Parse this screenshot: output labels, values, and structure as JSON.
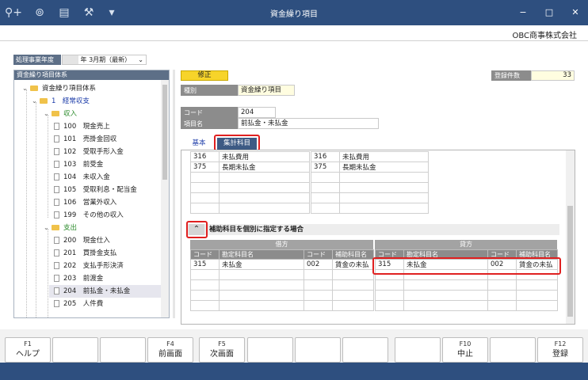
{
  "window": {
    "title": "資金繰り項目",
    "company": "OBC商事株式会社",
    "controls": {
      "minimize": "−",
      "maximize": "□",
      "close": "✕"
    }
  },
  "toolbar_icons": [
    "search-add-icon",
    "zoom-icon",
    "print-icon",
    "tools-icon",
    "dropdown-icon"
  ],
  "fiscal_year": {
    "label": "処理事業年度",
    "value": "年  3月期（最新）"
  },
  "tree": {
    "header": "資金繰り項目体系",
    "nodes": [
      {
        "label": "資金繰り項目体系"
      },
      {
        "label": "1　経常収支"
      },
      {
        "label": "収入"
      },
      {
        "code": "100",
        "name": "現金売上"
      },
      {
        "code": "101",
        "name": "売掛金回収"
      },
      {
        "code": "102",
        "name": "受取手形入金"
      },
      {
        "code": "103",
        "name": "前受金"
      },
      {
        "code": "104",
        "name": "未収入金"
      },
      {
        "code": "105",
        "name": "受取利息・配当金"
      },
      {
        "code": "106",
        "name": "営業外収入"
      },
      {
        "code": "199",
        "name": "その他の収入"
      },
      {
        "label": "支出"
      },
      {
        "code": "200",
        "name": "現金仕入"
      },
      {
        "code": "201",
        "name": "買掛金支払"
      },
      {
        "code": "202",
        "name": "支払手形決済"
      },
      {
        "code": "203",
        "name": "前渡金"
      },
      {
        "code": "204",
        "name": "前払金・未払金"
      },
      {
        "code": "205",
        "name": "人件費"
      }
    ]
  },
  "status": {
    "mode": "修正",
    "count_label": "登録件数",
    "count": "33"
  },
  "form": {
    "type_label": "種別",
    "type_value": "資金繰り項目",
    "code_label": "コード",
    "code_value": "204",
    "name_label": "項目名",
    "name_value": "前払金・未払金"
  },
  "tabs": {
    "basic": "基本",
    "summary": "集計科目"
  },
  "top_grid": {
    "left": [
      [
        "316",
        "未払費用"
      ],
      [
        "375",
        "長期未払金"
      ]
    ],
    "right": [
      [
        "316",
        "未払費用"
      ],
      [
        "375",
        "長期未払金"
      ]
    ]
  },
  "sub_section": {
    "title": "補助科目を個別に指定する場合",
    "debit": "借方",
    "credit": "貸方",
    "columns": [
      "コード",
      "勘定科目名",
      "コード",
      "補助科目名"
    ],
    "debit_rows": [
      [
        "315",
        "未払金",
        "002",
        "賃金の未払"
      ]
    ],
    "credit_rows": [
      [
        "315",
        "未払金",
        "002",
        "賃金の未払"
      ]
    ]
  },
  "fkeys": [
    {
      "key": "F1",
      "label": "ヘルプ"
    },
    {
      "key": "",
      "label": ""
    },
    {
      "key": "",
      "label": ""
    },
    {
      "key": "F4",
      "label": "前画面"
    },
    {
      "key": "F5",
      "label": "次画面"
    },
    {
      "key": "",
      "label": ""
    },
    {
      "key": "",
      "label": ""
    },
    {
      "key": "",
      "label": ""
    },
    {
      "key": "",
      "label": ""
    },
    {
      "key": "F10",
      "label": "中止"
    },
    {
      "key": "",
      "label": ""
    },
    {
      "key": "F12",
      "label": "登録"
    }
  ]
}
